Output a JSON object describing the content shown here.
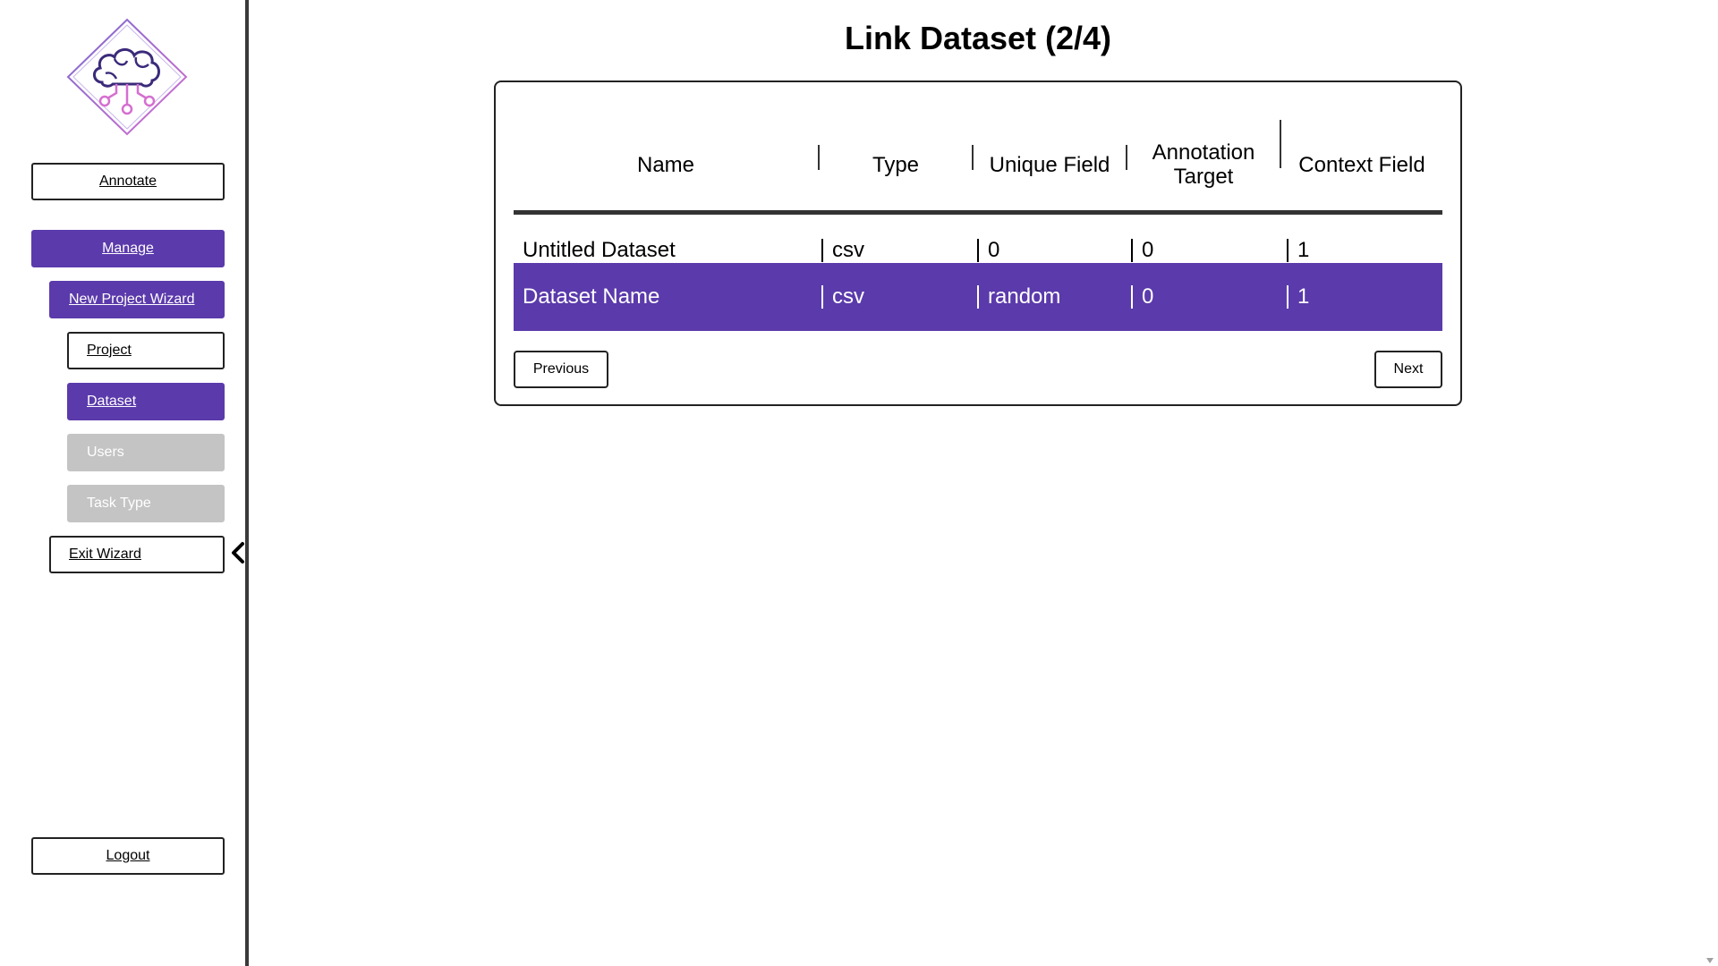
{
  "sidebar": {
    "annotate_label": "Annotate",
    "manage_label": "Manage",
    "wizard_label": "New Project Wizard",
    "project_label": "Project",
    "dataset_label": "Dataset",
    "users_label": "Users",
    "task_type_label": "Task Type",
    "exit_label": "Exit Wizard",
    "logout_label": "Logout"
  },
  "main": {
    "title": "Link Dataset (2/4)",
    "table": {
      "headers": [
        "Name",
        "Type",
        "Unique Field",
        "Annotation Target",
        "Context Field"
      ],
      "rows": [
        {
          "name": "Untitled Dataset",
          "type": "csv",
          "unique": "0",
          "target": "0",
          "context": "1",
          "selected": false
        },
        {
          "name": "Dataset Name",
          "type": "csv",
          "unique": "random",
          "target": "0",
          "context": "1",
          "selected": true
        }
      ]
    },
    "previous_label": "Previous",
    "next_label": "Next"
  },
  "colors": {
    "accent": "#5b3aab",
    "disabled": "#c4c4c4",
    "logo_purple": "#3b2a7a",
    "logo_pink": "#d56fd0"
  },
  "icons": {
    "logo": "brain-circuit-icon",
    "collapse": "chevron-left-icon"
  }
}
